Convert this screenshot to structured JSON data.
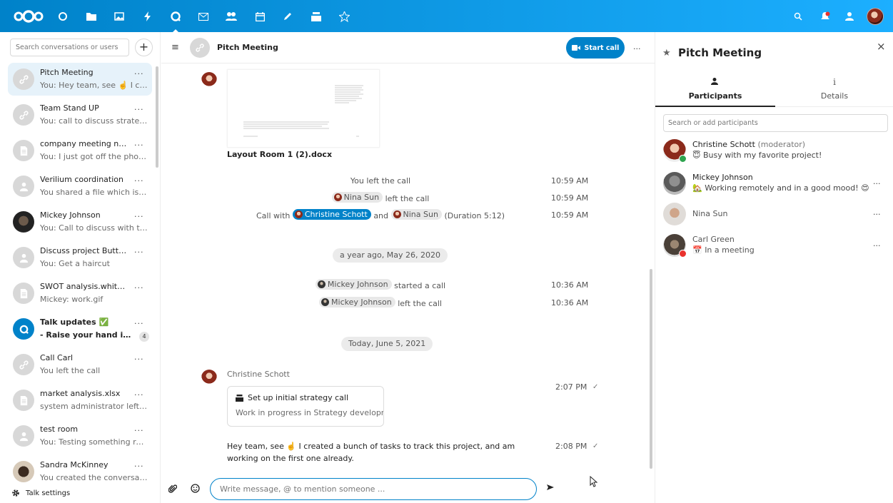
{
  "topbar": {
    "apps": [
      "dashboard-icon",
      "files-icon",
      "photos-icon",
      "activity-icon",
      "talk-icon",
      "mail-icon",
      "contacts-icon",
      "calendar-icon",
      "notes-icon",
      "deck-icon",
      "tasks-icon"
    ],
    "accent": "#0082c9"
  },
  "sidebar": {
    "search_placeholder": "Search conversations or users",
    "add_label": "+",
    "conversations": [
      {
        "title": "Pitch Meeting",
        "subtitle": "You: Hey team, see ☝️ I creat...",
        "icon": "link-icon"
      },
      {
        "title": "Team Stand UP",
        "subtitle": "You: call to discuss strategy",
        "icon": "link-icon"
      },
      {
        "title": "company meeting notes.md...",
        "subtitle": "You: I just got off the phone ...",
        "icon": "document-icon"
      },
      {
        "title": "Verilium coordination",
        "subtitle": "You shared a file which is no ...",
        "icon": "user-icon"
      },
      {
        "title": "Mickey Johnson",
        "subtitle": "You: Call to discuss with the ...",
        "icon": "avatar"
      },
      {
        "title": "Discuss project Butterscotch...",
        "subtitle": "You: Get a haircut",
        "icon": "user-icon"
      },
      {
        "title": "SWOT analysis.whiteboard",
        "subtitle": "Mickey: work.gif",
        "icon": "document-icon"
      },
      {
        "title": "Talk updates ✅",
        "subtitle": "- Raise your hand in a ca...",
        "icon": "talk-icon",
        "badge": "4"
      },
      {
        "title": "Call Carl",
        "subtitle": "You left the call",
        "icon": "link-icon"
      },
      {
        "title": "market analysis.xlsx",
        "subtitle": "system administrator left the ...",
        "icon": "document-icon"
      },
      {
        "title": "test room",
        "subtitle": "You: Testing something really...",
        "icon": "user-icon"
      },
      {
        "title": "Sandra McKinney",
        "subtitle": "You created the conversation",
        "icon": "avatar"
      }
    ],
    "menu_label": "...",
    "settings_label": "Talk settings"
  },
  "chat": {
    "title": "Pitch Meeting",
    "start_call_label": "Start call",
    "menu_label": "...",
    "file_name": "Layout Room 1 (2).docx",
    "system_messages": [
      {
        "text": "You left the call",
        "time": "10:59 AM"
      },
      {
        "mention": "Nina Sun",
        "text": "left the call",
        "time": "10:59 AM"
      },
      {
        "prefix": "Call with",
        "mention1": "Christine Schott",
        "and": "and",
        "mention2": "Nina Sun",
        "suffix": "(Duration 5:12)",
        "time": "10:59 AM"
      }
    ],
    "date_sep_1": "a year ago, May 26, 2020",
    "system_messages_2": [
      {
        "mention": "Mickey Johnson",
        "text": "started a call",
        "time": "10:36 AM"
      },
      {
        "mention": "Mickey Johnson",
        "text": "left the call",
        "time": "10:36 AM"
      }
    ],
    "date_sep_2": "Today, June 5, 2021",
    "author": "Christine Schott",
    "card": {
      "title": "Set up initial strategy call",
      "subtitle": "Work in progress in Strategy developme"
    },
    "card_time": "2:07 PM",
    "message": "Hey team, see ☝️ I created a bunch of tasks to track this project, and am working on the first one already.",
    "message_time": "2:08 PM",
    "composer_placeholder": "Write message, @ to mention someone ..."
  },
  "sidebar_right": {
    "title": "Pitch Meeting",
    "close_label": "×",
    "tabs": [
      {
        "label": "Participants"
      },
      {
        "label": "Details"
      }
    ],
    "search_placeholder": "Search or add participants",
    "participants": [
      {
        "name": "Christine Schott",
        "role": "(moderator)",
        "status": "😇 Busy with my favorite project!",
        "status_color": "#2ea44f"
      },
      {
        "name": "Mickey Johnson",
        "status": "🏡 Working remotely and in a good mood! 😍"
      },
      {
        "name": "Nina Sun",
        "status": ""
      },
      {
        "name": "Carl Green",
        "status": "📅 In a meeting",
        "status_color": "#e9322d"
      }
    ],
    "menu_label": "..."
  }
}
